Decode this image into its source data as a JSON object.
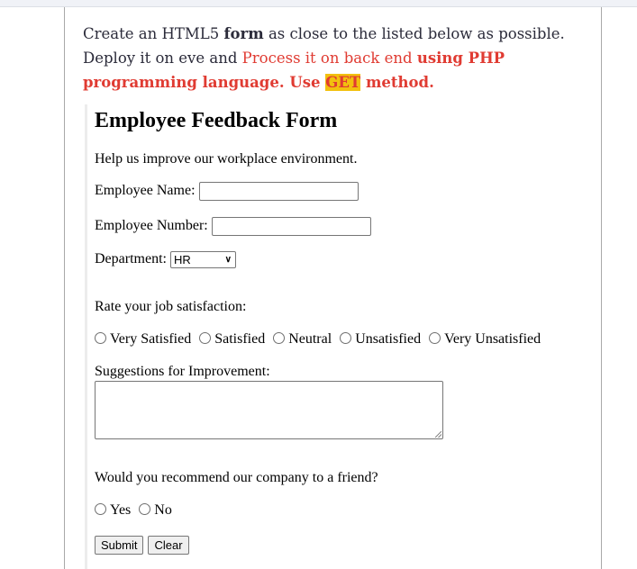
{
  "instructions": {
    "part1": "Create an HTML5 ",
    "form_word": "form",
    "part2": " as close to the listed below as possible. Deploy it on eve and ",
    "process_text": "Process it on back end ",
    "using_php": "using PHP programming language. Use ",
    "get_word": "GET",
    "method_text": " method."
  },
  "form": {
    "title": "Employee Feedback Form",
    "subtitle": "Help us improve our workplace environment.",
    "employee_name_label": "Employee Name:",
    "employee_name_value": "",
    "employee_number_label": "Employee Number:",
    "employee_number_value": "",
    "department_label": "Department:",
    "department_selected": "HR",
    "satisfaction_label": "Rate your job satisfaction:",
    "satisfaction_options": [
      "Very Satisfied",
      "Satisfied",
      "Neutral",
      "Unsatisfied",
      "Very Unsatisfied"
    ],
    "suggestions_label": "Suggestions for Improvement:",
    "suggestions_value": "",
    "recommend_label": "Would you recommend our company to a friend?",
    "recommend_options": [
      "Yes",
      "No"
    ],
    "submit_label": "Submit",
    "clear_label": "Clear"
  },
  "colors": {
    "accent_red": "#e03b32",
    "highlight_yellow": "#f2c00f"
  }
}
